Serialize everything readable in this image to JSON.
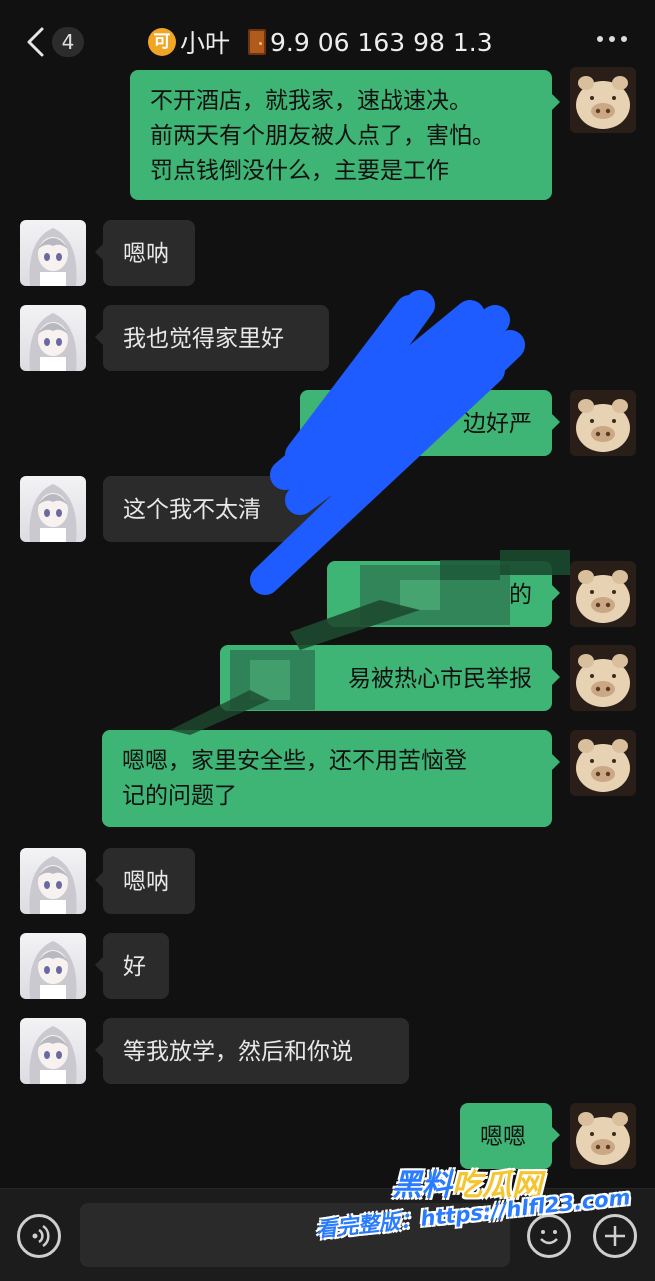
{
  "header": {
    "back_count": "4",
    "coin_char": "可",
    "contact_name": "小叶",
    "subtitle": "9.9  06 163 98 1.3"
  },
  "messages": [
    {
      "side": "out",
      "lines": [
        "不开酒店，就我家，速战速决。",
        "前两天有个朋友被人点了，害怕。",
        "罚点钱倒没什么，主要是工作"
      ]
    },
    {
      "side": "in",
      "text": "嗯呐"
    },
    {
      "side": "in",
      "text": "我也觉得家里好"
    },
    {
      "side": "out",
      "text": "边好严"
    },
    {
      "side": "in",
      "text": "这个我不太清"
    },
    {
      "side": "out",
      "text": "的"
    },
    {
      "side": "out",
      "text": "易被热心市民举报"
    },
    {
      "side": "out",
      "lines": [
        "嗯嗯，家里安全些，还不用苦恼登",
        "记的问题了"
      ]
    },
    {
      "side": "in",
      "text": "嗯呐"
    },
    {
      "side": "in",
      "text": "好"
    },
    {
      "side": "in",
      "text": "等我放学，然后和你说"
    },
    {
      "side": "out",
      "text": "嗯嗯"
    }
  ],
  "watermark": {
    "line1_a": "黑料",
    "line1_b": "吃瓜网",
    "line2": "看完整版：https://hlfl23.com"
  },
  "colors": {
    "background": "#111111",
    "bubble_out": "#3eb575",
    "bubble_in": "#2b2b2b",
    "scribble_blue": "#1f5cff",
    "scribble_green": "#1e5b3a"
  }
}
